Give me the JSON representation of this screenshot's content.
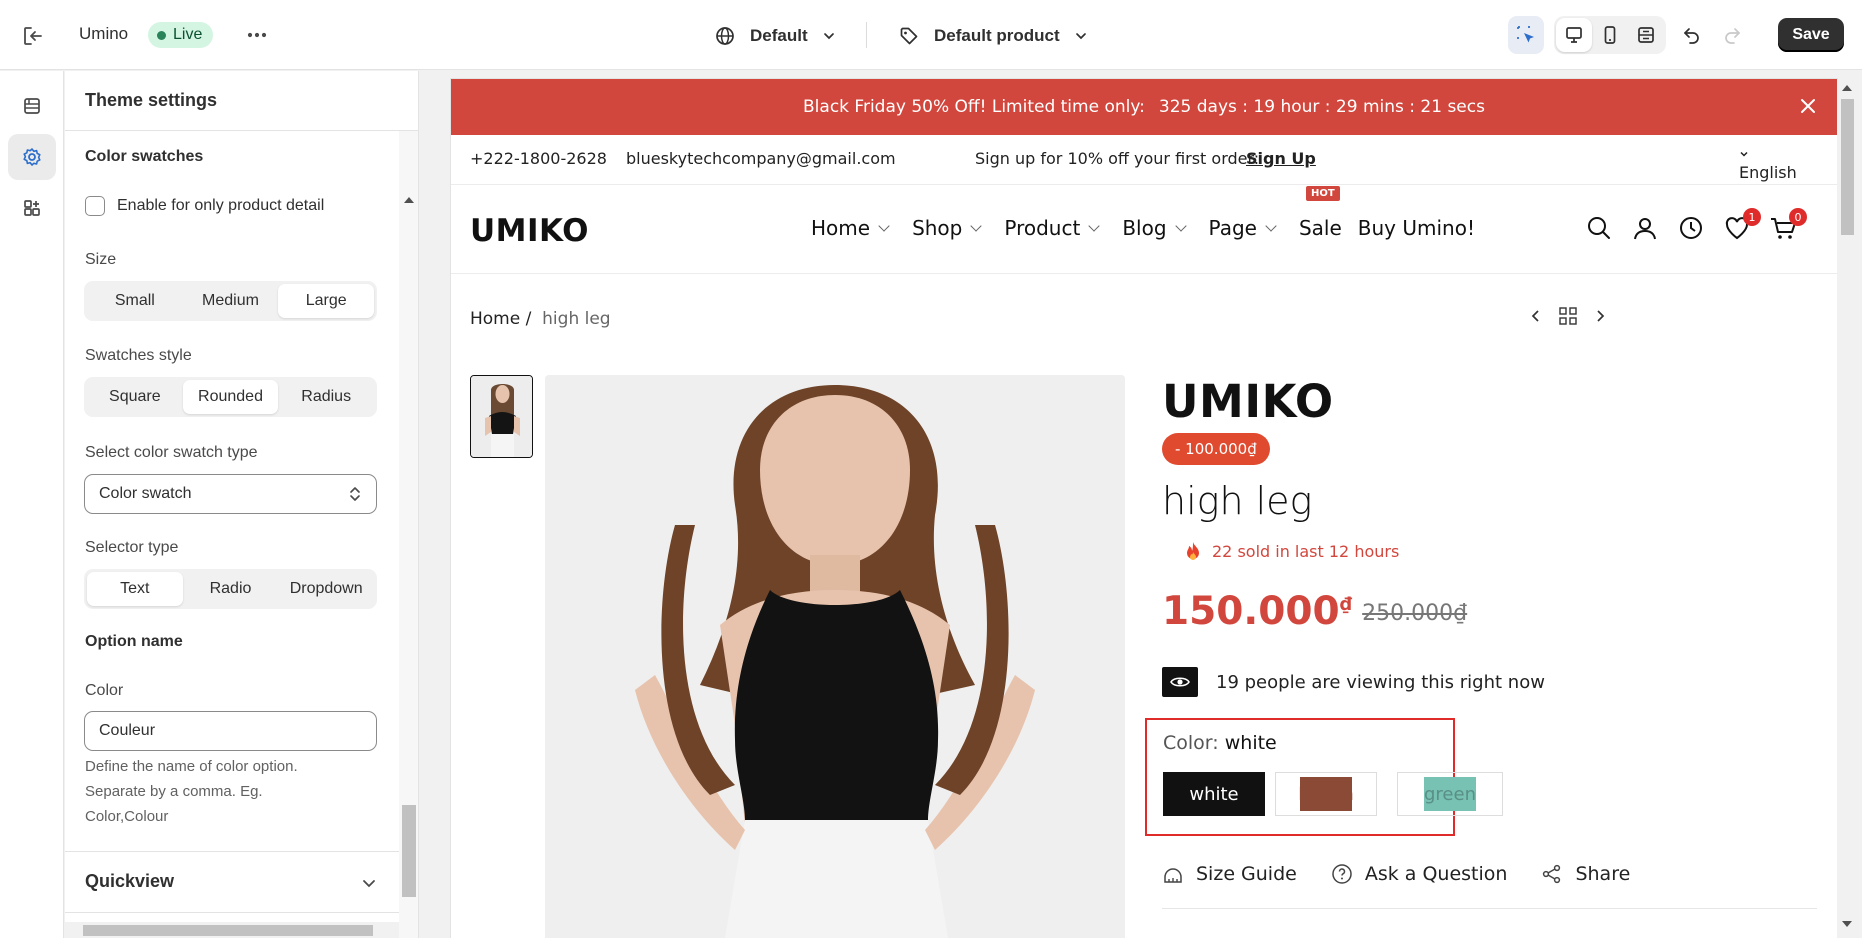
{
  "topbar": {
    "store_name": "Umino",
    "status": "Live",
    "theme_selector": "Default",
    "template_selector": "Default product",
    "save_label": "Save",
    "icons": [
      "exit-icon",
      "more-icon",
      "globe-icon",
      "tag-icon",
      "inspector-icon",
      "desktop-icon",
      "mobile-icon",
      "fullscreen-icon",
      "undo-icon",
      "redo-icon"
    ]
  },
  "rail": {
    "items": [
      "sections-icon",
      "theme-settings-icon",
      "apps-icon"
    ],
    "selected": "theme-settings-icon"
  },
  "panel": {
    "title": "Theme settings",
    "section_title": "Color swatches",
    "checkbox_label": "Enable for only product detail",
    "size": {
      "label": "Size",
      "options": [
        "Small",
        "Medium",
        "Large"
      ],
      "selected": "Large"
    },
    "swatches_style": {
      "label": "Swatches style",
      "options": [
        "Square",
        "Rounded",
        "Radius"
      ],
      "selected": "Rounded"
    },
    "swatch_type": {
      "label": "Select color swatch type",
      "value": "Color swatch"
    },
    "selector_type": {
      "label": "Selector type",
      "options": [
        "Text",
        "Radio",
        "Dropdown"
      ],
      "selected": "Text"
    },
    "option_name_title": "Option name",
    "color_label": "Color",
    "color_value": "Couleur",
    "help_lines": [
      "Define the name of color option.",
      "Separate by a comma. Eg.",
      "Color,Colour"
    ],
    "next_section": "Quickview"
  },
  "store": {
    "announcement": {
      "text": "Black Friday 50% Off! Limited time only:",
      "countdown": "325 days : 19 hour : 29 mins : 21 secs",
      "bg": "#d2473d"
    },
    "topinfo": {
      "phone": "+222-1800-2628",
      "email": "blueskytechcompany@gmail.com",
      "signup_text": "Sign up for 10% off your first order:",
      "signup_link": "Sign Up",
      "language": "English"
    },
    "logo": "UMIKO",
    "menu": [
      {
        "label": "Home",
        "dropdown": true
      },
      {
        "label": "Shop",
        "dropdown": true
      },
      {
        "label": "Product",
        "dropdown": true
      },
      {
        "label": "Blog",
        "dropdown": true
      },
      {
        "label": "Page",
        "dropdown": true
      },
      {
        "label": "Sale",
        "dropdown": false,
        "badge": "HOT"
      },
      {
        "label": "Buy Umino!",
        "dropdown": false
      }
    ],
    "nav_icons": {
      "wishlist_count": "1",
      "cart_count": "0"
    },
    "breadcrumb": {
      "home": "Home",
      "current": "high leg"
    },
    "product": {
      "brand_logo": "UMIKO",
      "discount": "- 100.000₫",
      "title": "high leg",
      "sold": "22 sold in last 12 hours",
      "price": "150.000",
      "currency": "₫",
      "compare_price": "250.000₫",
      "viewing": "19 people are viewing this right now",
      "color_label": "Color:",
      "color_selected": "white",
      "swatches": [
        {
          "name": "white",
          "color": "#111111"
        },
        {
          "name": "brown",
          "color": "#8b4a36"
        },
        {
          "name": "green",
          "color": "#77c2b2"
        }
      ],
      "links": [
        "Size Guide",
        "Ask a Question",
        "Share"
      ]
    }
  }
}
